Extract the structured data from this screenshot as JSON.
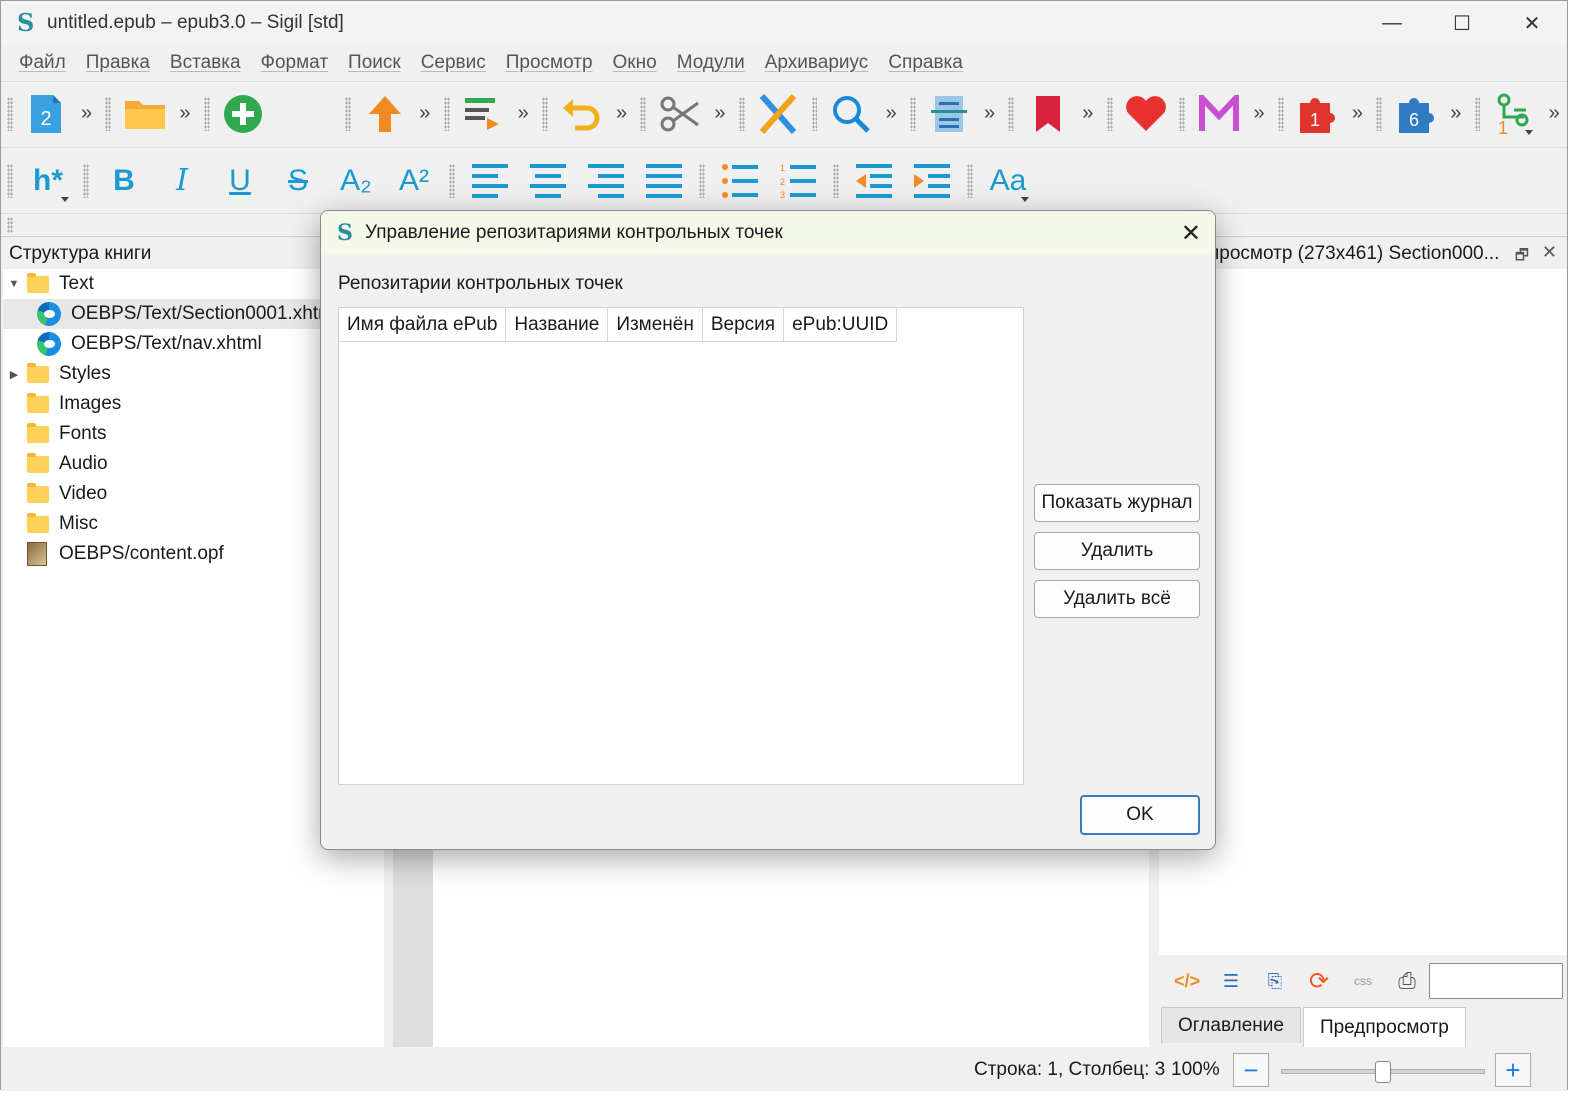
{
  "window": {
    "title": "untitled.epub – epub3.0 – Sigil [std]",
    "logo": "S",
    "controls": {
      "minimize": "—",
      "maximize": "☐",
      "close": "✕"
    }
  },
  "menu": [
    "Файл",
    "Правка",
    "Вставка",
    "Формат",
    "Поиск",
    "Сервис",
    "Просмотр",
    "Окно",
    "Модули",
    "Архивариус",
    "Справка"
  ],
  "toolbar1": {
    "ext": "»",
    "icons": [
      "new-book-icon",
      "open-folder-icon",
      "add-file-icon",
      "upload-arrow-icon",
      "insert-icon",
      "undo-icon",
      "cut-icon",
      "spellcheck-icon",
      "search-icon",
      "toc-icon",
      "bookmark-icon",
      "heart-icon",
      "metadata-m-icon",
      "plugin-red-icon",
      "plugin-blue-icon",
      "validate-icon"
    ],
    "new_badge": "2",
    "plugin_red_badge": "1",
    "plugin_blue_badge": "6",
    "validate_badge": "1"
  },
  "toolbar2": {
    "heading": "h*",
    "bold": "B",
    "italic": "I",
    "underline": "U",
    "strike": "S",
    "subscript": "A₂",
    "superscript": "A²",
    "case": "Aa"
  },
  "left_panel": {
    "title": "Структура книги",
    "tree": [
      {
        "label": "Text",
        "type": "folder",
        "expanded": true
      },
      {
        "label": "OEBPS/Text/Section0001.xhtml",
        "type": "xhtml",
        "selected": true
      },
      {
        "label": "OEBPS/Text/nav.xhtml",
        "type": "xhtml"
      },
      {
        "label": "Styles",
        "type": "folder",
        "collapsed": true
      },
      {
        "label": "Images",
        "type": "folder"
      },
      {
        "label": "Fonts",
        "type": "folder"
      },
      {
        "label": "Audio",
        "type": "folder"
      },
      {
        "label": "Video",
        "type": "folder"
      },
      {
        "label": "Misc",
        "type": "folder"
      },
      {
        "label": "OEBPS/content.opf",
        "type": "opf"
      }
    ]
  },
  "right_panel": {
    "title": "просмотр (273x461) Section000...",
    "float": "🗗",
    "close": "✕",
    "tools": [
      "</>",
      "☰",
      "⎘",
      "⟳",
      "css",
      "⎙"
    ],
    "tabs": [
      "Оглавление",
      "Предпросмотр"
    ]
  },
  "status": {
    "position": "Строка: 1, Столбец: 3",
    "zoom": "100%",
    "zoom_level": 0.5,
    "zoom_out": "−",
    "zoom_in": "+"
  },
  "dialog": {
    "logo": "S",
    "title": "Управление репозитариями контрольных точек",
    "close": "✕",
    "caption": "Репозитарии контрольных точек",
    "columns": [
      "Имя файла ePub",
      "Название",
      "Изменён",
      "Версия",
      "ePub:UUID"
    ],
    "rows": [],
    "buttons": {
      "show_log": "Показать журнал",
      "delete": "Удалить",
      "delete_all": "Удалить всё",
      "ok": "OK"
    }
  }
}
